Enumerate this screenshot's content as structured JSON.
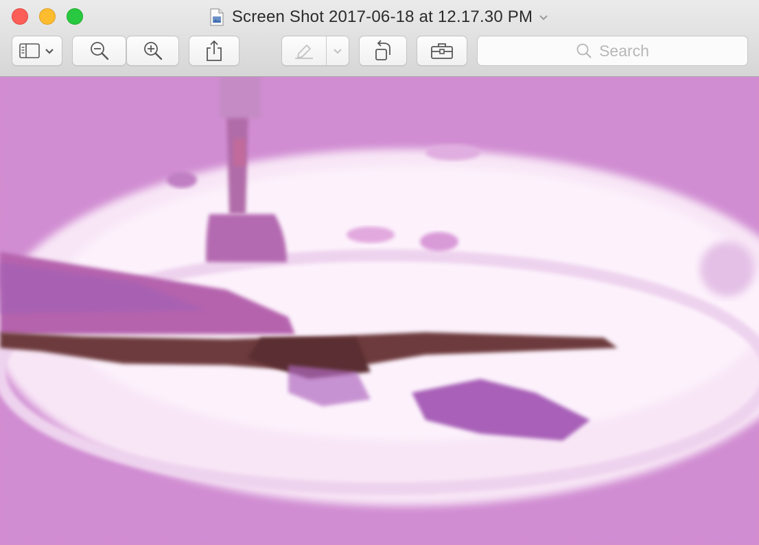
{
  "window": {
    "title": "Screen Shot 2017-06-18 at 12.17.30 PM",
    "title_icon": "document-image-icon",
    "title_menu_icon": "chevron-down-icon"
  },
  "traffic_lights": {
    "close_color": "#fc5f57",
    "minimize_color": "#fdbc2e",
    "zoom_color": "#28c840"
  },
  "toolbar": {
    "buttons": [
      {
        "name": "sidebar-toggle-button",
        "icon": "sidebar-icon",
        "menu_icon": "chevron-down-icon"
      },
      {
        "name": "zoom-out-button",
        "icon": "zoom-out-icon"
      },
      {
        "name": "zoom-in-button",
        "icon": "zoom-in-icon"
      },
      {
        "name": "share-button",
        "icon": "share-icon"
      },
      {
        "name": "markup-button",
        "icon": "pen-icon",
        "menu_icon": "chevron-down-icon",
        "enabled": false
      },
      {
        "name": "rotate-button",
        "icon": "rotate-left-icon"
      },
      {
        "name": "markup-toolbar-button",
        "icon": "toolbox-icon"
      }
    ],
    "search": {
      "placeholder": "Search",
      "icon": "search-icon"
    }
  },
  "document": {
    "content_icon": "photo-of-plate-with-fork"
  }
}
